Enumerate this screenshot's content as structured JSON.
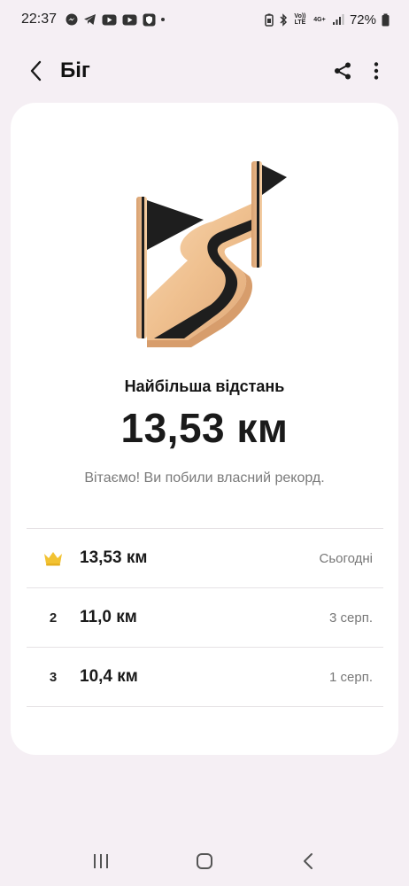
{
  "status_bar": {
    "time": "22:37",
    "battery": "72%",
    "volte": "Vo)) LTE",
    "net": "4G+"
  },
  "header": {
    "title": "Біг"
  },
  "record": {
    "title": "Найбільша відстань",
    "value": "13,53 км",
    "message": "Вітаємо! Ви побили власний рекорд."
  },
  "history": [
    {
      "rank": "",
      "distance": "13,53 км",
      "date": "Сьогодні"
    },
    {
      "rank": "2",
      "distance": "11,0 км",
      "date": "3 серп."
    },
    {
      "rank": "3",
      "distance": "10,4 км",
      "date": "1 серп."
    }
  ],
  "colors": {
    "background": "#f5eff4",
    "card": "#ffffff",
    "crown": "#f2c232",
    "badge_gold": "#f1c79a"
  }
}
